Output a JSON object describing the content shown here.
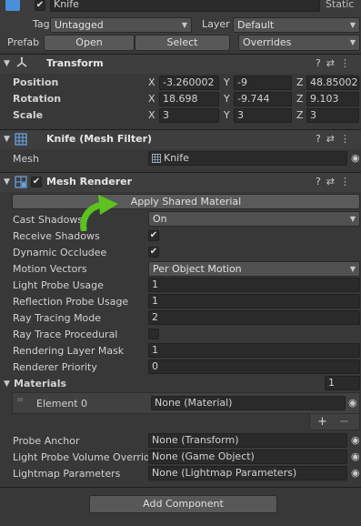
{
  "gameobject": {
    "name": "Knife",
    "static_label": "Static",
    "tag_label": "Tag",
    "tag_value": "Untagged",
    "layer_label": "Layer",
    "layer_value": "Default"
  },
  "prefab": {
    "label": "Prefab",
    "open": "Open",
    "select": "Select",
    "overrides": "Overrides"
  },
  "transform": {
    "title": "Transform",
    "position_label": "Position",
    "rotation_label": "Rotation",
    "scale_label": "Scale",
    "x": "X",
    "y": "Y",
    "z": "Z",
    "position": {
      "x": "-3.260002",
      "y": "-9",
      "z": "48.85002"
    },
    "rotation": {
      "x": "18.698",
      "y": "-9.744",
      "z": "9.103"
    },
    "scale": {
      "x": "3",
      "y": "3",
      "z": "3"
    }
  },
  "mesh_filter": {
    "title": "Knife (Mesh Filter)",
    "mesh_label": "Mesh",
    "mesh_value": "Knife"
  },
  "mesh_renderer": {
    "title": "Mesh Renderer",
    "apply_button": "Apply Shared Material",
    "cast_shadows_label": "Cast Shadows",
    "cast_shadows_value": "On",
    "receive_shadows_label": "Receive Shadows",
    "dynamic_occludee_label": "Dynamic Occludee",
    "motion_vectors_label": "Motion Vectors",
    "motion_vectors_value": "Per Object Motion",
    "light_probe_usage_label": "Light Probe Usage",
    "light_probe_usage_value": "1",
    "reflection_probe_usage_label": "Reflection Probe Usage",
    "reflection_probe_usage_value": "1",
    "ray_tracing_mode_label": "Ray Tracing Mode",
    "ray_tracing_mode_value": "2",
    "ray_trace_procedural_label": "Ray Trace Procedural",
    "rendering_layer_mask_label": "Rendering Layer Mask",
    "rendering_layer_mask_value": "1",
    "renderer_priority_label": "Renderer Priority",
    "renderer_priority_value": "0",
    "materials_label": "Materials",
    "materials_count": "1",
    "element0_label": "Element 0",
    "element0_value": "None (Material)",
    "add_symbol": "+",
    "remove_symbol": "−",
    "probe_anchor_label": "Probe Anchor",
    "probe_anchor_value": "None (Transform)",
    "lpvo_label": "Light Probe Volume Override",
    "lpvo_value": "None (Game Object)",
    "lightmap_params_label": "Lightmap Parameters",
    "lightmap_params_value": "None (Lightmap Parameters)"
  },
  "footer": {
    "add_component": "Add Component"
  },
  "icons": {
    "check": "✔",
    "caret": "▼",
    "fold_open": "▼",
    "picker": "◉",
    "help": "?",
    "settings": "⇄",
    "menu": "⋮"
  },
  "colors": {
    "background": "#383838",
    "header": "#3e3e3e",
    "field": "#2a2a2a",
    "arrow": "#5cc21e"
  }
}
